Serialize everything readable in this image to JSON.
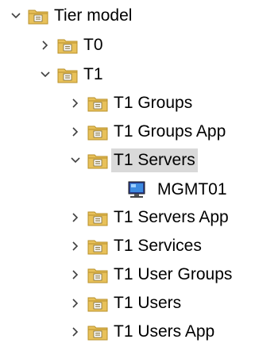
{
  "tree": {
    "root": {
      "label": "Tier model",
      "expanded": true,
      "icon": "ou-folder-icon"
    },
    "t0": {
      "label": "T0",
      "expanded": false,
      "icon": "ou-folder-icon"
    },
    "t1": {
      "label": "T1",
      "expanded": true,
      "icon": "ou-folder-icon"
    },
    "t1_groups": {
      "label": "T1 Groups",
      "expanded": false,
      "icon": "ou-folder-icon"
    },
    "t1_groups_app": {
      "label": "T1 Groups App",
      "expanded": false,
      "icon": "ou-folder-icon"
    },
    "t1_servers": {
      "label": "T1 Servers",
      "expanded": true,
      "selected": true,
      "icon": "ou-folder-icon"
    },
    "mgmt01": {
      "label": "MGMT01",
      "icon": "computer-icon"
    },
    "t1_servers_app": {
      "label": "T1 Servers App",
      "expanded": false,
      "icon": "ou-folder-icon"
    },
    "t1_services": {
      "label": "T1 Services",
      "expanded": false,
      "icon": "ou-folder-icon"
    },
    "t1_user_groups": {
      "label": "T1 User Groups",
      "expanded": false,
      "icon": "ou-folder-icon"
    },
    "t1_users": {
      "label": "T1 Users",
      "expanded": false,
      "icon": "ou-folder-icon"
    },
    "t1_users_app": {
      "label": "T1 Users App",
      "expanded": false,
      "icon": "ou-folder-icon"
    }
  },
  "colors": {
    "folder": "#e8c15a",
    "folder_dark": "#b8902a",
    "selection": "#d9d9d9",
    "chevron": "#404040"
  }
}
